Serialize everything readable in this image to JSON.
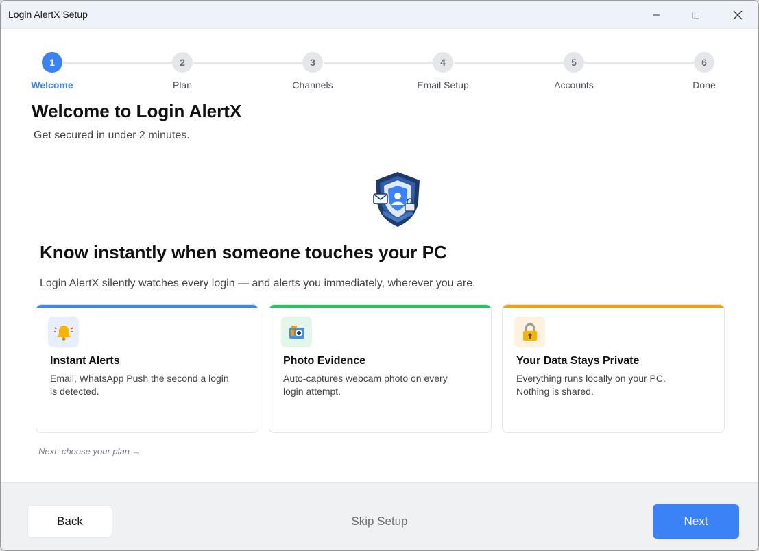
{
  "window": {
    "title": "Login AlertX Setup",
    "controls": {
      "minimize_icon": "minimize-icon",
      "maximize_icon": "maximize-icon",
      "close_icon": "close-icon"
    }
  },
  "stepper": {
    "steps": [
      {
        "number": "1",
        "label": "Welcome",
        "active": true
      },
      {
        "number": "2",
        "label": "Plan",
        "active": false
      },
      {
        "number": "3",
        "label": "Channels",
        "active": false
      },
      {
        "number": "4",
        "label": "Email Setup",
        "active": false
      },
      {
        "number": "5",
        "label": "Accounts",
        "active": false
      },
      {
        "number": "6",
        "label": "Done",
        "active": false
      }
    ],
    "active_color": "#3b82f6"
  },
  "main": {
    "title": "Welcome to Login AlertX",
    "subtitle": "Get secured in under 2 minutes.",
    "hero_icon": "shield-icon",
    "headline": "Know instantly when someone touches your PC",
    "lead": "Login AlertX silently watches every login — and alerts you immediately, wherever you are.",
    "features": [
      {
        "icon": "bell-icon",
        "title": "Instant Alerts",
        "description": "Email, WhatsApp  Push the second a login\nis detected.",
        "accent": "#3b82f6"
      },
      {
        "icon": "camera-icon",
        "title": "Photo Evidence",
        "description": "Auto-captures webcam photo on every\nlogin attempt.",
        "accent": "#22c55e"
      },
      {
        "icon": "lock-icon",
        "title": "Your Data Stays Private",
        "description": "Everything runs locally on your PC.\nNothing is shared.",
        "accent": "#f59e0b"
      }
    ],
    "next_hint": "Next: choose your plan  →"
  },
  "footer": {
    "back_label": "Back",
    "skip_label": "Skip Setup",
    "next_label": "Next"
  }
}
